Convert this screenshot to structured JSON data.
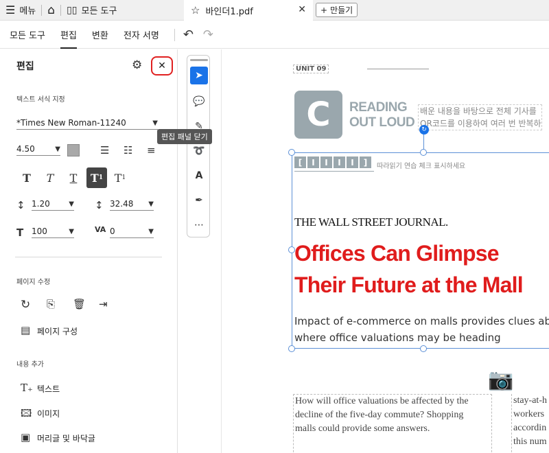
{
  "tabbar": {
    "menu_label": "메뉴",
    "all_tools_label": "모든 도구",
    "active_tab_title": "바인더1.pdf",
    "new_tab_label": "만들기"
  },
  "menubar": {
    "items": [
      "모든 도구",
      "편집",
      "변환",
      "전자 서명"
    ],
    "active_index": 1
  },
  "panel": {
    "title": "편집",
    "close_tooltip": "편집 패널 닫기",
    "text_format": {
      "label": "텍스트 서식 지정",
      "font_name": "*Times New Roman-11240",
      "font_size": "4.50",
      "line_spacing": "1.20",
      "para_spacing": "32.48",
      "horizontal_scale": "100",
      "char_spacing": "0"
    },
    "page_edit": {
      "label": "페이지 수정",
      "organize_label": "페이지 구성"
    },
    "add_content": {
      "label": "내용 추가",
      "text_label": "텍스트",
      "image_label": "이미지",
      "header_footer_label": "머리글 및 바닥글"
    }
  },
  "document": {
    "unit": "UNIT 09",
    "logo_letter": "C",
    "read_aloud_line1": "READING",
    "read_aloud_line2": "OUT LOUD",
    "desc_line1": "배운 내용을 바탕으로 전체 기사를",
    "desc_line2": "QR코드를 이용하여 여러 번 반복하",
    "check_hint": "따라읽기 연습 체크 표시하세요",
    "masthead": "THE WALL STREET JOURNAL.",
    "headline_line1": "Offices Can Glimpse",
    "headline_line2": "Their Future at the Mall",
    "subhead_line1": "Impact of e-commerce on malls provides clues abou",
    "subhead_line2": "where office valuations may be heading",
    "body_left_1": "How will office valuations be affected by the",
    "body_left_2": "decline of the five-day commute? Shopping",
    "body_left_3": "malls could provide some answers.",
    "body_right_1": "stay-at-h",
    "body_right_2": "workers",
    "body_right_3": "accordin",
    "body_right_4": "this num"
  },
  "colors": {
    "accent": "#1a73e8",
    "headline": "#e01c1c",
    "logo_gray": "#9aa7ad",
    "close_outline": "#e02020"
  }
}
